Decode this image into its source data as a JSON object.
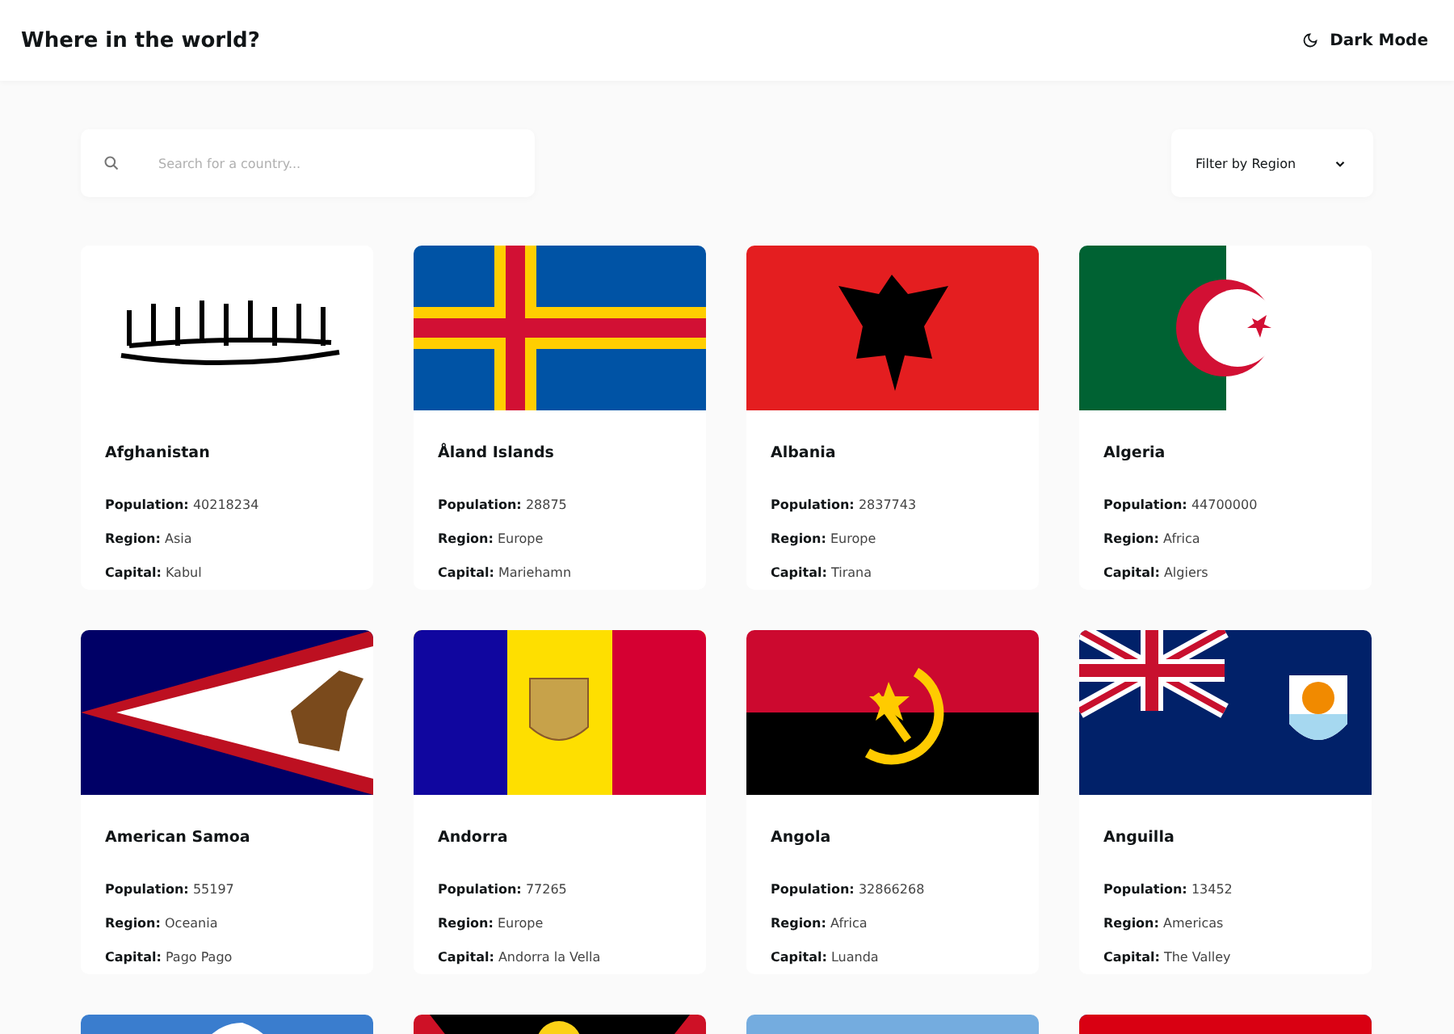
{
  "header": {
    "title": "Where in the world?",
    "theme_toggle": "Dark Mode"
  },
  "search": {
    "placeholder": "Search for a country..."
  },
  "filter": {
    "label": "Filter by Region"
  },
  "countries": [
    {
      "kind": "afghanistan",
      "name": "Afghanistan",
      "population_label": "Population:",
      "population": "40218234",
      "region_label": "Region:",
      "region": "Asia",
      "capital_label": "Capital:",
      "capital": "Kabul"
    },
    {
      "kind": "aland",
      "name": "Åland Islands",
      "population_label": "Population:",
      "population": "28875",
      "region_label": "Region:",
      "region": "Europe",
      "capital_label": "Capital:",
      "capital": "Mariehamn"
    },
    {
      "kind": "albania",
      "name": "Albania",
      "population_label": "Population:",
      "population": "2837743",
      "region_label": "Region:",
      "region": "Europe",
      "capital_label": "Capital:",
      "capital": "Tirana"
    },
    {
      "kind": "algeria",
      "name": "Algeria",
      "population_label": "Population:",
      "population": "44700000",
      "region_label": "Region:",
      "region": "Africa",
      "capital_label": "Capital:",
      "capital": "Algiers"
    },
    {
      "kind": "american-samoa",
      "name": "American Samoa",
      "population_label": "Population:",
      "population": "55197",
      "region_label": "Region:",
      "region": "Oceania",
      "capital_label": "Capital:",
      "capital": "Pago Pago"
    },
    {
      "kind": "andorra",
      "name": "Andorra",
      "population_label": "Population:",
      "population": "77265",
      "region_label": "Region:",
      "region": "Europe",
      "capital_label": "Capital:",
      "capital": "Andorra la Vella"
    },
    {
      "kind": "angola",
      "name": "Angola",
      "population_label": "Population:",
      "population": "32866268",
      "region_label": "Region:",
      "region": "Africa",
      "capital_label": "Capital:",
      "capital": "Luanda"
    },
    {
      "kind": "anguilla",
      "name": "Anguilla",
      "population_label": "Population:",
      "population": "13452",
      "region_label": "Region:",
      "region": "Americas",
      "capital_label": "Capital:",
      "capital": "The Valley"
    },
    {
      "kind": "antarctica"
    },
    {
      "kind": "antigua"
    },
    {
      "kind": "argentina"
    },
    {
      "kind": "armenia"
    }
  ]
}
